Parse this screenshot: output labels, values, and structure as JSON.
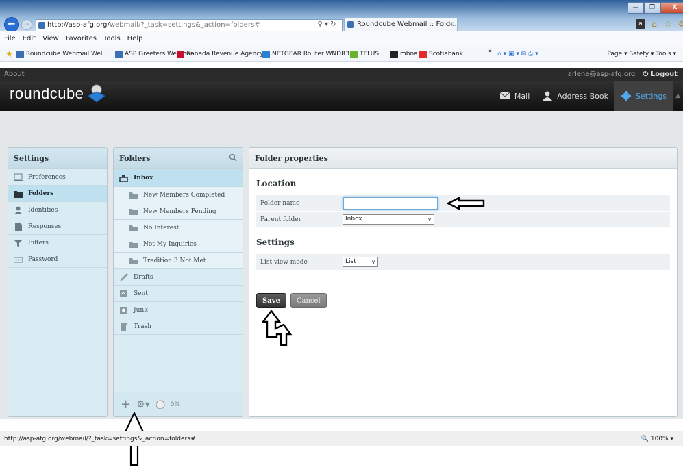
{
  "browser": {
    "url_host": "http://asp-afg.org/",
    "url_path": "webmail/?_task=settings&_action=folders#",
    "address_controls": "⚲ ▾ ↻",
    "tab_title": "Roundcube Webmail :: Fold...",
    "tab_close": "×",
    "menu": [
      "File",
      "Edit",
      "View",
      "Favorites",
      "Tools",
      "Help"
    ],
    "favorites": [
      {
        "label": "Roundcube Webmail Wel...",
        "color": "#3b6fb5"
      },
      {
        "label": "ASP Greeters Webmail",
        "color": "#3b6fb5"
      },
      {
        "label": "Canada Revenue Agency ...",
        "color": "#c8102e"
      },
      {
        "label": "NETGEAR Router WNDR3...",
        "color": "#2a7fd4"
      },
      {
        "label": "TELUS",
        "color": "#6bb22e"
      },
      {
        "label": "mbna",
        "color": "#222222"
      },
      {
        "label": "Scotiabank",
        "color": "#e32b2b"
      }
    ],
    "fav_overflow": "»",
    "toolbar_right": "Page ▾   Safety ▾   Tools ▾",
    "status_url": "http://asp-afg.org/webmail/?_task=settings&_action=folders#",
    "zoom": "100%"
  },
  "app": {
    "about": "About",
    "user": "arlene@asp-afg.org",
    "logout": "Logout",
    "logo": "roundcube",
    "nav": [
      {
        "label": "Mail",
        "icon": "mail-icon"
      },
      {
        "label": "Address Book",
        "icon": "address-book-icon"
      },
      {
        "label": "Settings",
        "icon": "settings-gear-icon",
        "selected": true
      }
    ]
  },
  "settings_panel": {
    "title": "Settings",
    "items": [
      {
        "label": "Preferences",
        "icon": "preferences-icon"
      },
      {
        "label": "Folders",
        "icon": "folders-icon",
        "selected": true
      },
      {
        "label": "Identities",
        "icon": "identities-icon"
      },
      {
        "label": "Responses",
        "icon": "responses-icon"
      },
      {
        "label": "Filters",
        "icon": "filter-icon"
      },
      {
        "label": "Password",
        "icon": "password-icon"
      }
    ]
  },
  "folders_panel": {
    "title": "Folders",
    "items": [
      {
        "label": "Inbox",
        "level": 0,
        "selected": true,
        "icon": "inbox-icon"
      },
      {
        "label": "New Members Completed",
        "level": 1,
        "icon": "folder-icon"
      },
      {
        "label": "New Members Pending",
        "level": 1,
        "icon": "folder-icon"
      },
      {
        "label": "No Interest",
        "level": 1,
        "icon": "folder-icon"
      },
      {
        "label": "Not My Inquiries",
        "level": 1,
        "icon": "folder-icon"
      },
      {
        "label": "Tradition 3 Not Met",
        "level": 1,
        "icon": "folder-icon"
      },
      {
        "label": "Drafts",
        "level": 0,
        "icon": "drafts-icon"
      },
      {
        "label": "Sent",
        "level": 0,
        "icon": "sent-icon"
      },
      {
        "label": "Junk",
        "level": 0,
        "icon": "junk-icon"
      },
      {
        "label": "Trash",
        "level": 0,
        "icon": "trash-icon"
      }
    ],
    "quota": "0%"
  },
  "properties": {
    "title": "Folder properties",
    "location_heading": "Location",
    "folder_name_label": "Folder name",
    "folder_name_value": "",
    "parent_label": "Parent folder",
    "parent_value": "Inbox",
    "settings_heading": "Settings",
    "view_mode_label": "List view mode",
    "view_mode_value": "List",
    "save": "Save",
    "cancel": "Cancel"
  },
  "colors": {
    "accent": "#4fa9ea",
    "header": "#1e1e1e",
    "panel": "#d9ecf4"
  }
}
